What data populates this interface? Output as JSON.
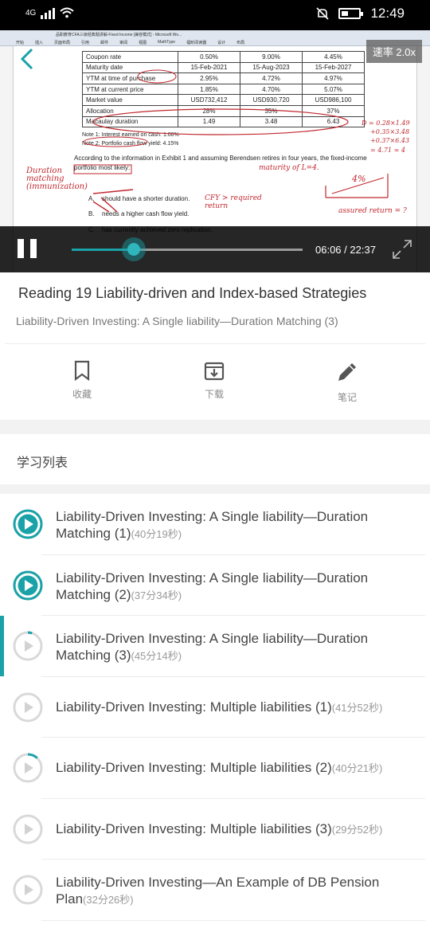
{
  "status_bar": {
    "network": "4G",
    "time": "12:49"
  },
  "player": {
    "doc_title": "品职教育CFA三级经典题讲解-Fixed Income [兼容模式] - Microsoft Wo...",
    "doc_menu": [
      "开始",
      "插入",
      "页面布局",
      "引用",
      "邮件",
      "审阅",
      "视图",
      "MathType",
      "福昕阅读器",
      "设计",
      "布局"
    ],
    "speed_label": "速率 2.0x",
    "current_time": "06:06",
    "separator": "/",
    "total_time": "22:37",
    "progress": 0.27,
    "table": [
      [
        "Coupon rate",
        "0.50%",
        "9.00%",
        "4.45%"
      ],
      [
        "Maturity date",
        "15-Feb-2021",
        "15-Aug-2023",
        "15-Feb-2027"
      ],
      [
        "YTM at time of purchase",
        "2.95%",
        "4.72%",
        "4.97%"
      ],
      [
        "YTM at current price",
        "1.85%",
        "4.70%",
        "5.07%"
      ],
      [
        "Market value",
        "USD732,412",
        "USD930,720",
        "USD986,100"
      ],
      [
        "Allocation",
        "28%",
        "35%",
        "37%"
      ],
      [
        "Macaulay duration",
        "1.49",
        "3.48",
        "6.43"
      ]
    ],
    "note1": "Note 1: Interest earned on cash: 1.00%",
    "note2": "Note 2: Portfolio cash flow yield: 4.15%",
    "question": "According to the information in Exhibit 1 and assuming Berendsen retires in four years, the fixed-income portfolio most likely:",
    "options": [
      {
        "key": "A.",
        "text": "should have a shorter duration."
      },
      {
        "key": "B.",
        "text": "needs a higher cash flow yield."
      },
      {
        "key": "C.",
        "text": "has currently achieved zero replication."
      }
    ],
    "handwriting": {
      "left_note": "Duration matching (immunization)",
      "horizon": "maturity of L=4.",
      "cf_note": "CFY > required return",
      "calc1": "D = 0.28×1.49",
      "calc2": "+0.35×3.48",
      "calc3": "+0.37×6.43",
      "calc4": "= 4.71 ≈ 4",
      "pct": "4%",
      "assured": "assured return = ?"
    }
  },
  "lesson": {
    "title": "Reading 19 Liability-driven and Index-based Strategies",
    "subtitle": "Liability-Driven Investing: A Single liability—Duration Matching (3)"
  },
  "actions": [
    {
      "label": "收藏",
      "icon": "bookmark-icon"
    },
    {
      "label": "下载",
      "icon": "download-icon"
    },
    {
      "label": "笔记",
      "icon": "pencil-icon"
    }
  ],
  "list_title": "学习列表",
  "playlist": [
    {
      "title": "Liability-Driven Investing: A Single liability—Duration Matching (1)",
      "duration": "(40分19秒)",
      "state": "completed",
      "progress": 1.0
    },
    {
      "title": "Liability-Driven Investing: A Single liability—Duration Matching (2)",
      "duration": "(37分34秒)",
      "state": "completed",
      "progress": 1.0
    },
    {
      "title": "Liability-Driven Investing: A Single liability—Duration Matching (3)",
      "duration": "(45分14秒)",
      "state": "playing",
      "progress": 0.05
    },
    {
      "title": "Liability-Driven Investing: Multiple liabilities (1)",
      "duration": "(41分52秒)",
      "state": "not-started",
      "progress": 0
    },
    {
      "title": "Liability-Driven Investing: Multiple liabilities (2)",
      "duration": "(40分21秒)",
      "state": "partial",
      "progress": 0.12
    },
    {
      "title": "Liability-Driven Investing: Multiple liabilities (3)",
      "duration": "(29分52秒)",
      "state": "not-started",
      "progress": 0
    },
    {
      "title": "Liability-Driven Investing—An Example of DB Pension Plan",
      "duration": "(32分26秒)",
      "state": "not-started",
      "progress": 0
    }
  ],
  "colors": {
    "accent": "#1aa2a8",
    "ring_grey": "#d9d9d9"
  }
}
